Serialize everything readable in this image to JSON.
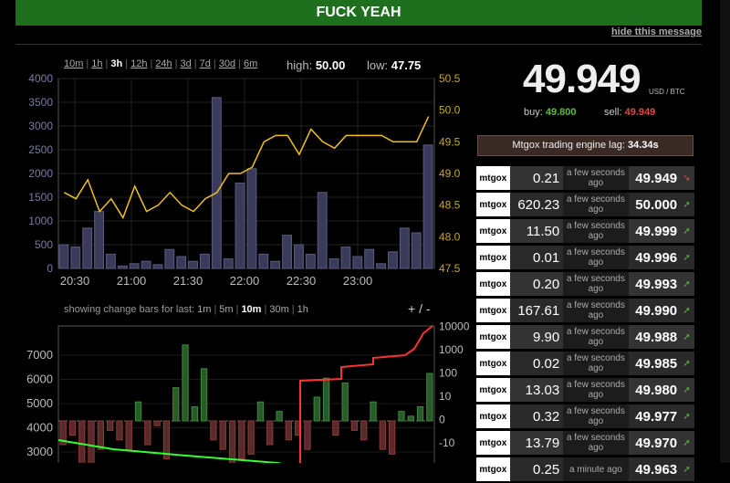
{
  "banner": {
    "text": "FUCK YEAH",
    "hide_label": "hide tthis message"
  },
  "ranges": [
    {
      "label": "10m",
      "active": false
    },
    {
      "label": "1h",
      "active": false
    },
    {
      "label": "3h",
      "active": true
    },
    {
      "label": "12h",
      "active": false
    },
    {
      "label": "24h",
      "active": false
    },
    {
      "label": "3d",
      "active": false
    },
    {
      "label": "7d",
      "active": false
    },
    {
      "label": "30d",
      "active": false
    },
    {
      "label": "6m",
      "active": false
    }
  ],
  "stats": {
    "high_label": "high:",
    "high": "50.00",
    "low_label": "low:",
    "low": "47.75"
  },
  "change_bars": {
    "label": "showing change bars for last:",
    "options": [
      {
        "label": "1m",
        "active": false
      },
      {
        "label": "5m",
        "active": false
      },
      {
        "label": "10m",
        "active": true
      },
      {
        "label": "30m",
        "active": false
      },
      {
        "label": "1h",
        "active": false
      }
    ],
    "plus": "+",
    "minus": "-"
  },
  "ticker": {
    "price": "49.949",
    "currency": "USD / BTC",
    "buy_label": "buy:",
    "buy": "49.800",
    "sell_label": "sell:",
    "sell": "49.949",
    "lag_label": "Mtgox trading engine lag:",
    "lag": "34.34s"
  },
  "colors": {
    "up": "#5dbb3f",
    "down": "#e04545",
    "banner": "#1e6f1e",
    "price_line": "#f0c020",
    "volume_bar": "#3a3a5a"
  },
  "trades": [
    {
      "exchange": "mtgox",
      "amount": "0.21",
      "time": "a few seconds ago",
      "price": "49.949",
      "dir": "down"
    },
    {
      "exchange": "mtgox",
      "amount": "620.23",
      "time": "a few seconds ago",
      "price": "50.000",
      "dir": "up"
    },
    {
      "exchange": "mtgox",
      "amount": "11.50",
      "time": "a few seconds ago",
      "price": "49.999",
      "dir": "up"
    },
    {
      "exchange": "mtgox",
      "amount": "0.01",
      "time": "a few seconds ago",
      "price": "49.996",
      "dir": "up"
    },
    {
      "exchange": "mtgox",
      "amount": "0.20",
      "time": "a few seconds ago",
      "price": "49.993",
      "dir": "up"
    },
    {
      "exchange": "mtgox",
      "amount": "167.61",
      "time": "a few seconds ago",
      "price": "49.990",
      "dir": "up"
    },
    {
      "exchange": "mtgox",
      "amount": "9.90",
      "time": "a few seconds ago",
      "price": "49.988",
      "dir": "up"
    },
    {
      "exchange": "mtgox",
      "amount": "0.02",
      "time": "a few seconds ago",
      "price": "49.985",
      "dir": "up"
    },
    {
      "exchange": "mtgox",
      "amount": "13.03",
      "time": "a few seconds ago",
      "price": "49.980",
      "dir": "up"
    },
    {
      "exchange": "mtgox",
      "amount": "0.32",
      "time": "a few seconds ago",
      "price": "49.977",
      "dir": "up"
    },
    {
      "exchange": "mtgox",
      "amount": "13.79",
      "time": "a few seconds ago",
      "price": "49.970",
      "dir": "up"
    },
    {
      "exchange": "mtgox",
      "amount": "0.25",
      "time": "a minute ago",
      "price": "49.963",
      "dir": "up"
    }
  ],
  "chart_data": [
    {
      "type": "bar",
      "x_ticks": [
        "20:30",
        "21:00",
        "21:30",
        "22:00",
        "22:30",
        "23:00"
      ],
      "y_left_ticks": [
        "0",
        "500",
        "1000",
        "1500",
        "2000",
        "2500",
        "3000",
        "3500",
        "4000"
      ],
      "y_right_ticks": [
        "47.5",
        "48.0",
        "48.5",
        "49.0",
        "49.5",
        "50.0",
        "50.5"
      ],
      "volume": [
        500,
        450,
        850,
        1200,
        300,
        50,
        100,
        150,
        80,
        400,
        250,
        150,
        300,
        3600,
        200,
        1800,
        2100,
        300,
        150,
        700,
        500,
        300,
        1600,
        200,
        450,
        250,
        400,
        100,
        350,
        850,
        750,
        2600
      ],
      "price": [
        48.7,
        48.6,
        48.9,
        48.4,
        48.6,
        48.3,
        48.8,
        48.4,
        48.5,
        48.7,
        48.5,
        48.4,
        48.6,
        48.7,
        49.0,
        49.0,
        49.1,
        49.5,
        49.6,
        49.6,
        49.3,
        49.7,
        49.5,
        49.4,
        49.6,
        49.6,
        49.6,
        49.6,
        49.5,
        49.5,
        49.5,
        49.9
      ],
      "ylim_volume": [
        0,
        4000
      ],
      "ylim_price": [
        47.5,
        50.5
      ]
    },
    {
      "type": "bar",
      "y_left_ticks": [
        "3000",
        "4000",
        "5000",
        "6000",
        "7000"
      ],
      "y_right_ticks": [
        "-10",
        "0",
        "10",
        "100",
        "1000",
        "10000"
      ],
      "changes": [
        -0.5,
        -0.3,
        -1,
        -0.9,
        -0.6,
        -0.2,
        -0.4,
        -0.6,
        0.4,
        -0.5,
        -0.1,
        -0.8,
        0.7,
        1.6,
        0.3,
        1.1,
        -0.4,
        -0.6,
        -0.9,
        -0.8,
        -0.7,
        0.4,
        -0.5,
        0.2,
        -0.4,
        -0.3,
        -0.6,
        0.5,
        0.9,
        -0.3,
        0.8,
        -0.2,
        -0.4,
        0.4,
        -0.6,
        -0.7,
        0.2,
        0.1,
        0.3,
        1.0
      ]
    }
  ]
}
